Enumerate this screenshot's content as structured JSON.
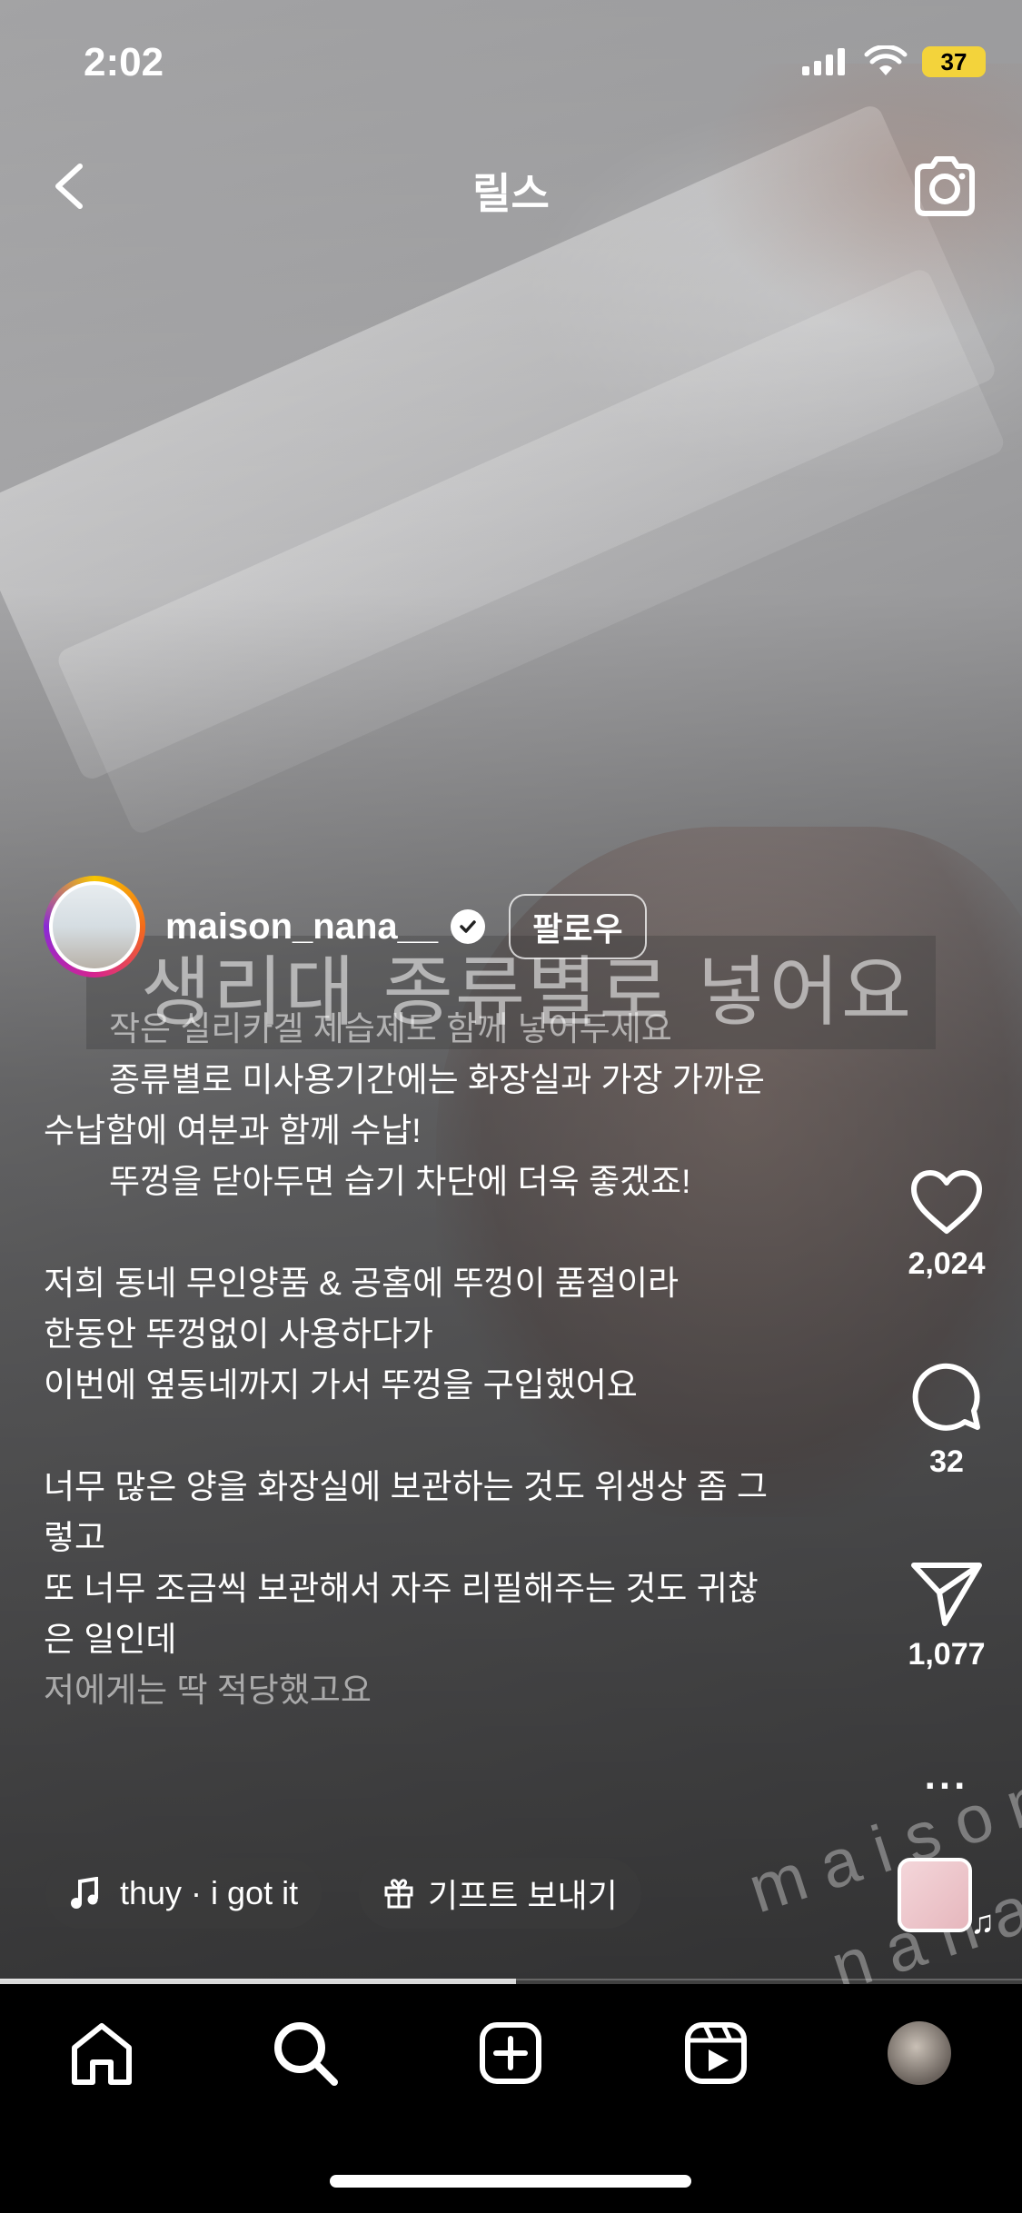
{
  "status_bar": {
    "time": "2:02",
    "battery": "37"
  },
  "header": {
    "title": "릴스"
  },
  "video": {
    "overlay_subtitle": "생리대 종류별로 넣어요"
  },
  "post": {
    "username": "maison_nana__",
    "follow_label": "팔로우",
    "caption_lines": [
      "작은 실리카겔 제습제도 함께 넣어두세요",
      "종류별로 미사용기간에는 화장실과 가장 가까운",
      "수납함에 여분과 함께 수납!",
      "뚜껑을 닫아두면 습기 차단에 더욱 좋겠죠!",
      "저희 동네 무인양품 & 공홈에 뚜껑이 품절이라",
      "한동안 뚜껑없이 사용하다가",
      "이번에 옆동네까지 가서 뚜껑을 구입했어요",
      "너무 많은 양을 화장실에 보관하는 것도 위생상 좀 그",
      "렇고",
      "또 너무 조금씩 보관해서 자주 리필해주는 것도 귀찮",
      "은 일인데",
      "저에게는 딱 적당했고요"
    ],
    "music_label": "thuy · i got it",
    "gift_label": "기프트 보내기",
    "watermark": [
      "maison",
      "nana"
    ]
  },
  "actions": {
    "likes": "2,024",
    "comments": "32",
    "shares": "1,077",
    "more": "..."
  },
  "progress": 0.505,
  "colors": {
    "battery": "#f3d33b",
    "background": "#000000"
  },
  "nav": {
    "items": [
      "home-icon",
      "search-icon",
      "create-icon",
      "reels-icon",
      "profile-avatar"
    ]
  }
}
